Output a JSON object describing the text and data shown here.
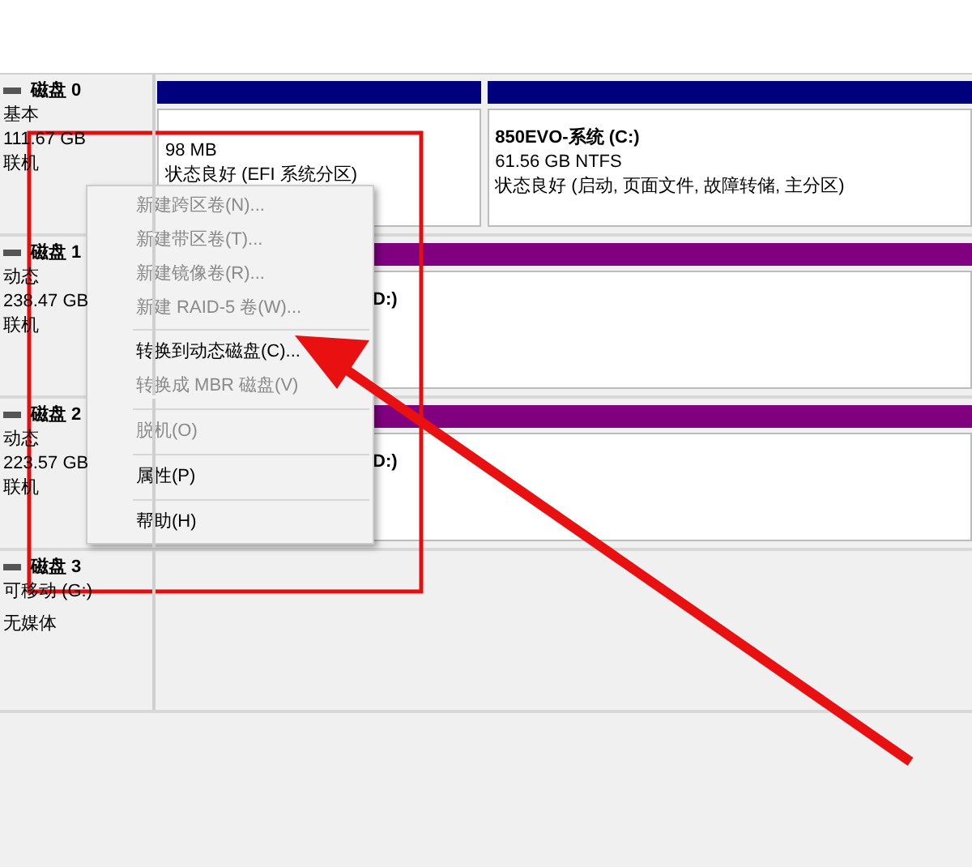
{
  "disks": [
    {
      "name": "磁盘 0",
      "type": "基本",
      "size": "111.67 GB",
      "status": "联机",
      "partitions": [
        {
          "color": "#00007f",
          "lines": [
            "98 MB",
            "状态良好 (EFI 系统分区)"
          ]
        },
        {
          "color": "#00007f",
          "title": "850EVO-系统 (C:)",
          "lines": [
            "61.56 GB NTFS",
            "状态良好 (启动, 页面文件, 故障转储, 主分区)"
          ]
        }
      ]
    },
    {
      "name": "磁盘 1",
      "type": "动态",
      "size": "238.47 GB",
      "status": "联机",
      "partitions": [
        {
          "color": "#800080",
          "title": "D:)"
        }
      ]
    },
    {
      "name": "磁盘 2",
      "type": "动态",
      "size": "223.57 GB",
      "status": "联机",
      "partitions": [
        {
          "color": "#800080",
          "title": "D:)"
        }
      ]
    },
    {
      "name": "磁盘 3",
      "type": "可移动 (G:)",
      "status": "无媒体"
    }
  ],
  "context_menu": [
    {
      "kind": "item",
      "label": "新建跨区卷(N)...",
      "disabled": true
    },
    {
      "kind": "item",
      "label": "新建带区卷(T)...",
      "disabled": true
    },
    {
      "kind": "item",
      "label": "新建镜像卷(R)...",
      "disabled": true
    },
    {
      "kind": "item",
      "label": "新建 RAID-5 卷(W)...",
      "disabled": true
    },
    {
      "kind": "separator"
    },
    {
      "kind": "item",
      "label": "转换到动态磁盘(C)...",
      "disabled": false
    },
    {
      "kind": "item",
      "label": "转换成 MBR 磁盘(V)",
      "disabled": true
    },
    {
      "kind": "separator"
    },
    {
      "kind": "item",
      "label": "脱机(O)",
      "disabled": true
    },
    {
      "kind": "separator"
    },
    {
      "kind": "item",
      "label": "属性(P)",
      "disabled": false
    },
    {
      "kind": "separator"
    },
    {
      "kind": "item",
      "label": "帮助(H)",
      "disabled": false
    }
  ]
}
